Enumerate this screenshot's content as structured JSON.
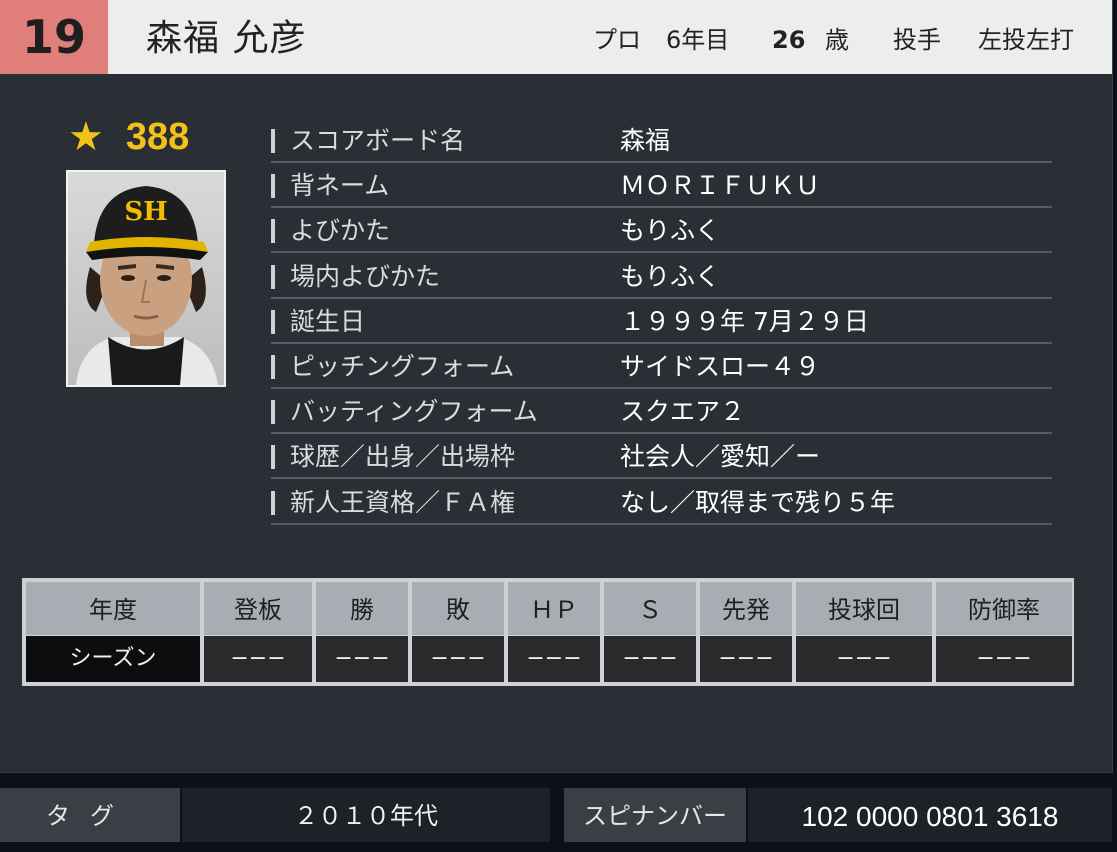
{
  "header": {
    "number": "19",
    "name": "森福 允彦",
    "pro_label": "プロ",
    "pro_years": "6年目",
    "age_value": "26",
    "age_unit": "歳",
    "position": "投手",
    "handedness": "左投左打"
  },
  "rating": {
    "icon": "star-icon",
    "score": "388"
  },
  "portrait": {
    "cap_logo": "SH"
  },
  "profile": [
    {
      "label": "スコアボード名",
      "value": "森福"
    },
    {
      "label": "背ネーム",
      "value": "ＭＯＲＩＦＵＫＵ"
    },
    {
      "label": "よびかた",
      "value": "もりふく"
    },
    {
      "label": "場内よびかた",
      "value": "もりふく"
    },
    {
      "label": "誕生日",
      "value": "１９９９年 7月２９日"
    },
    {
      "label": "ピッチングフォーム",
      "value": "サイドスロー４９"
    },
    {
      "label": "バッティングフォーム",
      "value": "スクエア２"
    },
    {
      "label": "球歴／出身／出場枠",
      "value": "社会人／愛知／ー"
    },
    {
      "label": "新人王資格／ＦＡ権",
      "value": "なし／取得まで残り５年"
    }
  ],
  "stats": {
    "headers": [
      "年度",
      "登板",
      "勝",
      "敗",
      "ＨＰ",
      "Ｓ",
      "先発",
      "投球回",
      "防御率"
    ],
    "row": [
      "シーズン",
      "−−−",
      "−−−",
      "−−−",
      "−−−",
      "−−−",
      "−−−",
      "−−−",
      "−−−"
    ]
  },
  "footer": {
    "tag_label": "タグ",
    "tag_value": "２０１０年代",
    "spin_label": "スピナンバー",
    "spin_value": "102 0000 0801 3618"
  },
  "colors": {
    "number_bg": "#e07e7a",
    "star": "#f3c21a",
    "panel": "#2a2e35"
  }
}
